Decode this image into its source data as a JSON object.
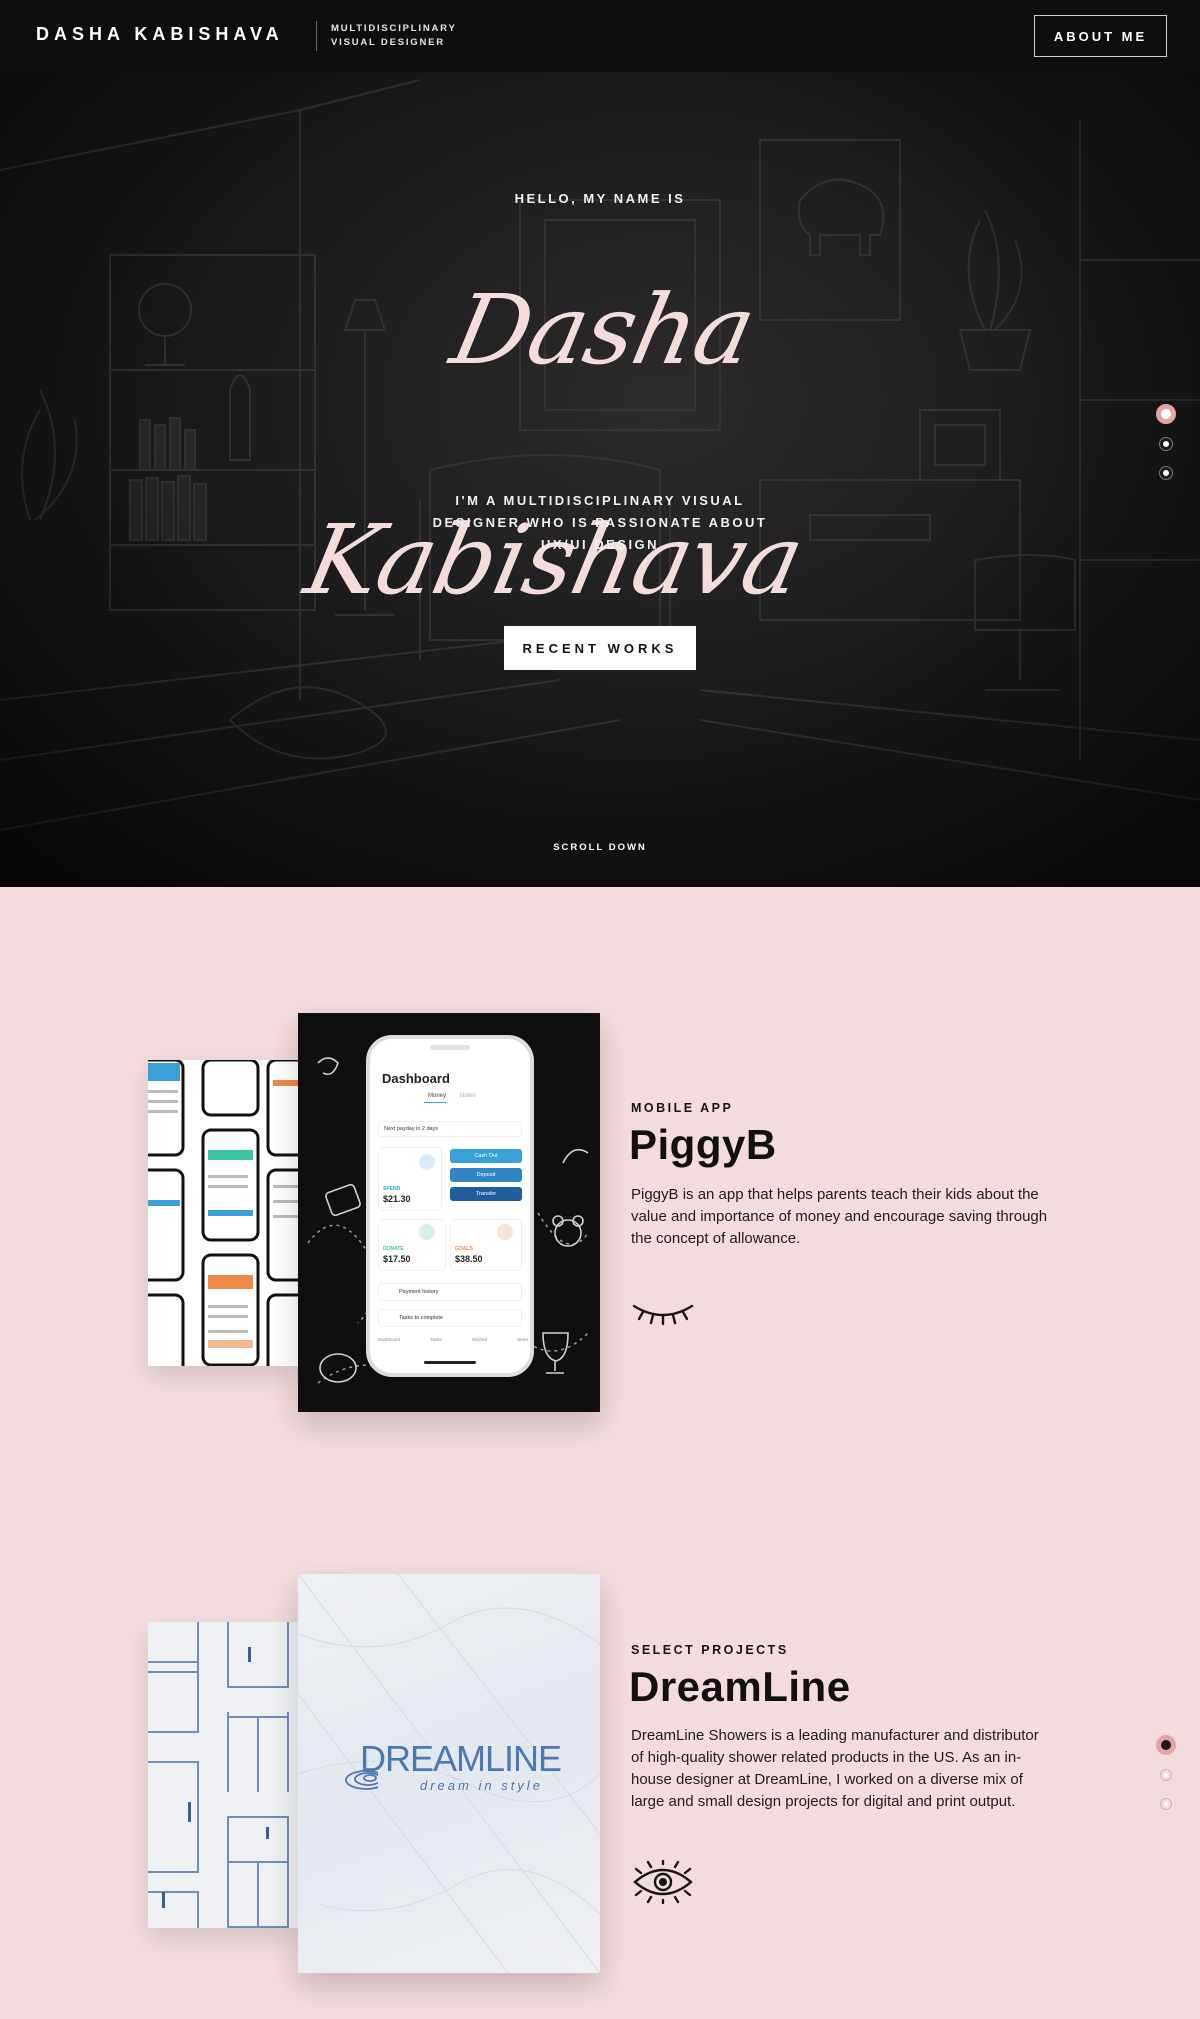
{
  "header": {
    "brand_name": "DASHA KABISHAVA",
    "tagline": "MULTIDISCIPLINARY VISUAL DESIGNER",
    "about_label": "ABOUT ME"
  },
  "hero": {
    "hello": "HELLO, MY NAME IS",
    "script_name": "Dasha Kabishava",
    "intro": "I'M A MULTIDISCIPLINARY VISUAL DESIGNER WHO IS PASSIONATE ABOUT UX/UI DESIGN",
    "cta_label": "RECENT WORKS",
    "scroll_label": "SCROLL DOWN"
  },
  "projects": [
    {
      "kicker": "MOBILE APP",
      "title": "PiggyB",
      "description": "PiggyB is an app that helps parents teach their kids about the value and importance of money and encourage saving through the concept of allowance.",
      "icon": "closed-eye-icon",
      "mockup": {
        "screen_title": "Dashboard",
        "tab_active": "Money",
        "tab_other": "Notes",
        "notice": "Next payday in 2 days",
        "spend_label": "SPEND",
        "spend_value": "$21.30",
        "donate_label": "DONATE",
        "donate_value": "$17.50",
        "goals_label": "GOALS",
        "goals_value": "$38.50",
        "action_1": "Cash Out",
        "action_2": "Deposit",
        "action_3": "Transfer",
        "row_1": "Payment history",
        "row_2": "Tasks to complete",
        "nav": [
          "Dashboard",
          "Tasks",
          "Wished",
          "Store"
        ]
      }
    },
    {
      "kicker": "SELECT PROJECTS",
      "title": "DreamLine",
      "description": "DreamLine Showers is a leading manufacturer and distributor of high-quality shower related products in the US. As an in-house designer at DreamLine, I worked on a diverse mix of large and small design projects for digital and print output.",
      "icon": "open-eye-icon",
      "logo_text": "DREAMLINE",
      "logo_sub": "dream in style"
    }
  ],
  "colors": {
    "accent_pink": "#e7a3a4",
    "page_bg": "#f2dcdd",
    "dark_bg": "#0e0e0f"
  }
}
